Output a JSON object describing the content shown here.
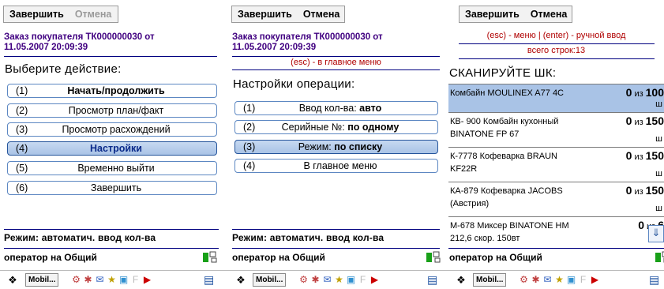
{
  "screens": [
    {
      "toolbar": {
        "finish_label": "Завершить",
        "cancel_label": "Отмена",
        "cancel_disabled": true
      },
      "order_title_line1": "Заказ покупателя ТК000000030 от",
      "order_title_line2": "11.05.2007 20:09:39",
      "prompt": "Выберите действие:",
      "menu": [
        {
          "num": "(1)",
          "label": "Начать/продолжить",
          "bold": true,
          "active": false
        },
        {
          "num": "(2)",
          "label": "Просмотр план/факт",
          "bold": false,
          "active": false
        },
        {
          "num": "(3)",
          "label": "Просмотр расхождений",
          "bold": false,
          "active": false
        },
        {
          "num": "(4)",
          "label": "Настройки",
          "bold": true,
          "active": true
        },
        {
          "num": "(5)",
          "label": "Временно выйти",
          "bold": false,
          "active": false
        },
        {
          "num": "(6)",
          "label": "Завершить",
          "bold": false,
          "active": false
        }
      ],
      "mode": "Режим: автоматич. ввод кол-ва",
      "operator": "оператор на Общий"
    },
    {
      "toolbar": {
        "finish_label": "Завершить",
        "cancel_label": "Отмена",
        "cancel_disabled": false
      },
      "order_title_line1": "Заказ покупателя ТК000000030 от",
      "order_title_line2": "11.05.2007 20:09:39",
      "hint": "(esc) - в главное меню",
      "prompt": "Настройки операции:",
      "menu": [
        {
          "num": "(1)",
          "label": "Ввод кол-ва: ",
          "value": "авто",
          "active": false
        },
        {
          "num": "(2)",
          "label": "Серийные №: ",
          "value": "по одному",
          "active": false
        },
        {
          "num": "(3)",
          "label": "Режим: ",
          "value": "по списку",
          "active": true
        },
        {
          "num": "(4)",
          "label": "В главное меню",
          "value": "",
          "active": false
        }
      ],
      "mode": "Режим: автоматич. ввод кол-ва",
      "operator": "оператор на Общий"
    },
    {
      "toolbar": {
        "finish_label": "Завершить",
        "cancel_label": "Отмена",
        "cancel_disabled": false
      },
      "hint": "(esc) - меню | (enter) - ручной ввод",
      "total": "всего строк:13",
      "prompt": "СКАНИРУЙТЕ ШК:",
      "items": [
        {
          "name": "Комбайн MOULINEX  A77 4C",
          "done": "0",
          "of": "из",
          "plan": "100",
          "unit": "ш",
          "selected": true
        },
        {
          "name": "КВ- 900 Комбайн кухонный BINATONE FP 67",
          "done": "0",
          "of": "из",
          "plan": "150",
          "unit": "ш",
          "selected": false
        },
        {
          "name": "К-7778 Кофеварка BRAUN KF22R",
          "done": "0",
          "of": "из",
          "plan": "150",
          "unit": "ш",
          "selected": false
        },
        {
          "name": "КА-879 Кофеварка JACOBS (Австрия)",
          "done": "0",
          "of": "из",
          "plan": "150",
          "unit": "ш",
          "selected": false
        },
        {
          "name": "М-678 Миксер BINATONE HM 212,6 скор. 150вт",
          "done": "0",
          "of": "из",
          "plan": "6",
          "unit": "ш",
          "selected": false
        }
      ],
      "operator": "оператор на Общий"
    }
  ],
  "taskbar": {
    "app_label": "Mobil...",
    "start_icon": "windows-flag-icon"
  }
}
